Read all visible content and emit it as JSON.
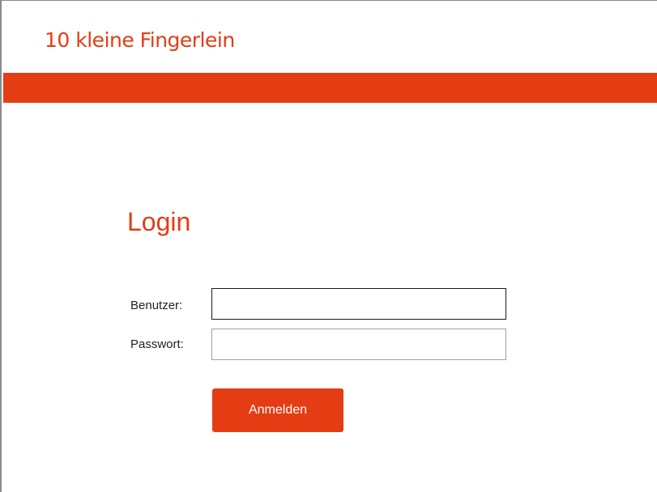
{
  "header": {
    "brand": "10 kleine Fingerlein"
  },
  "login": {
    "title": "Login",
    "user_label": "Benutzer:",
    "user_value": "",
    "password_label": "Passwort:",
    "password_value": "",
    "submit_label": "Anmelden"
  },
  "colors": {
    "accent": "#e43d14",
    "background": "#ffffff"
  }
}
